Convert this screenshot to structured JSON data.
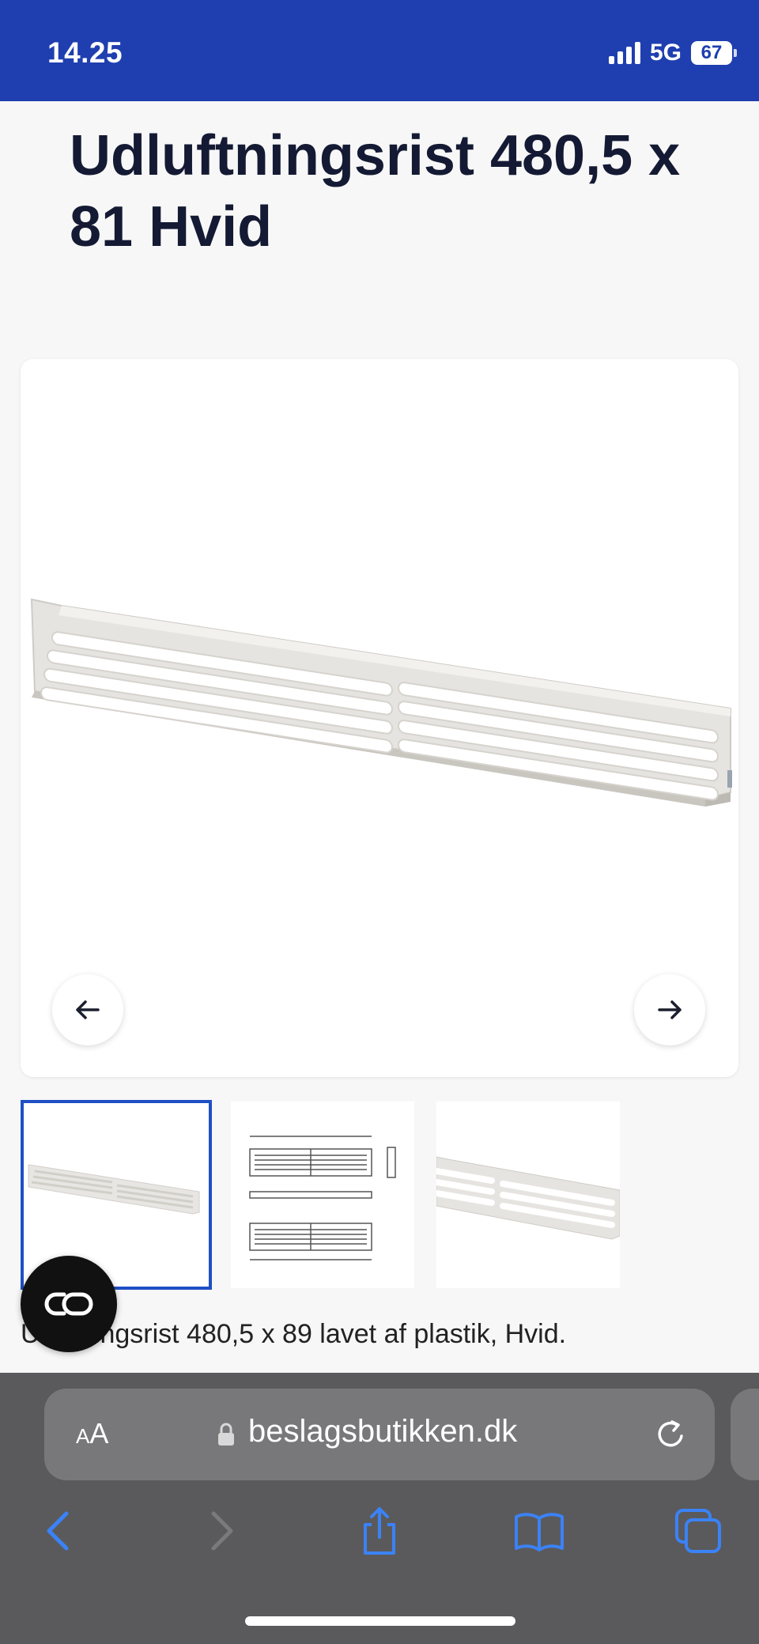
{
  "status": {
    "time": "14.25",
    "network": "5G",
    "battery": "67"
  },
  "product": {
    "title": "Udluftningsrist 480,5 x 81 Hvid",
    "description_prefix": "U",
    "description_visible": "tningsrist 480,5 x 89 lavet af plastik, Hvid."
  },
  "gallery": {
    "prev_icon": "arrow-left-icon",
    "next_icon": "arrow-right-icon",
    "thumbnails": [
      "product-photo",
      "technical-drawing",
      "product-photo-closeup"
    ],
    "selected_thumbnail": "1"
  },
  "floating_button": {
    "icon": "link-icon"
  },
  "browser": {
    "aa_label_small": "A",
    "aa_label_large": "A",
    "url": "beslagsbutikken.dk",
    "accent_color": "#3b82f6"
  },
  "colors": {
    "header": "#1f3fb0",
    "selected_border": "#1f4fc4",
    "title": "#141a33"
  }
}
